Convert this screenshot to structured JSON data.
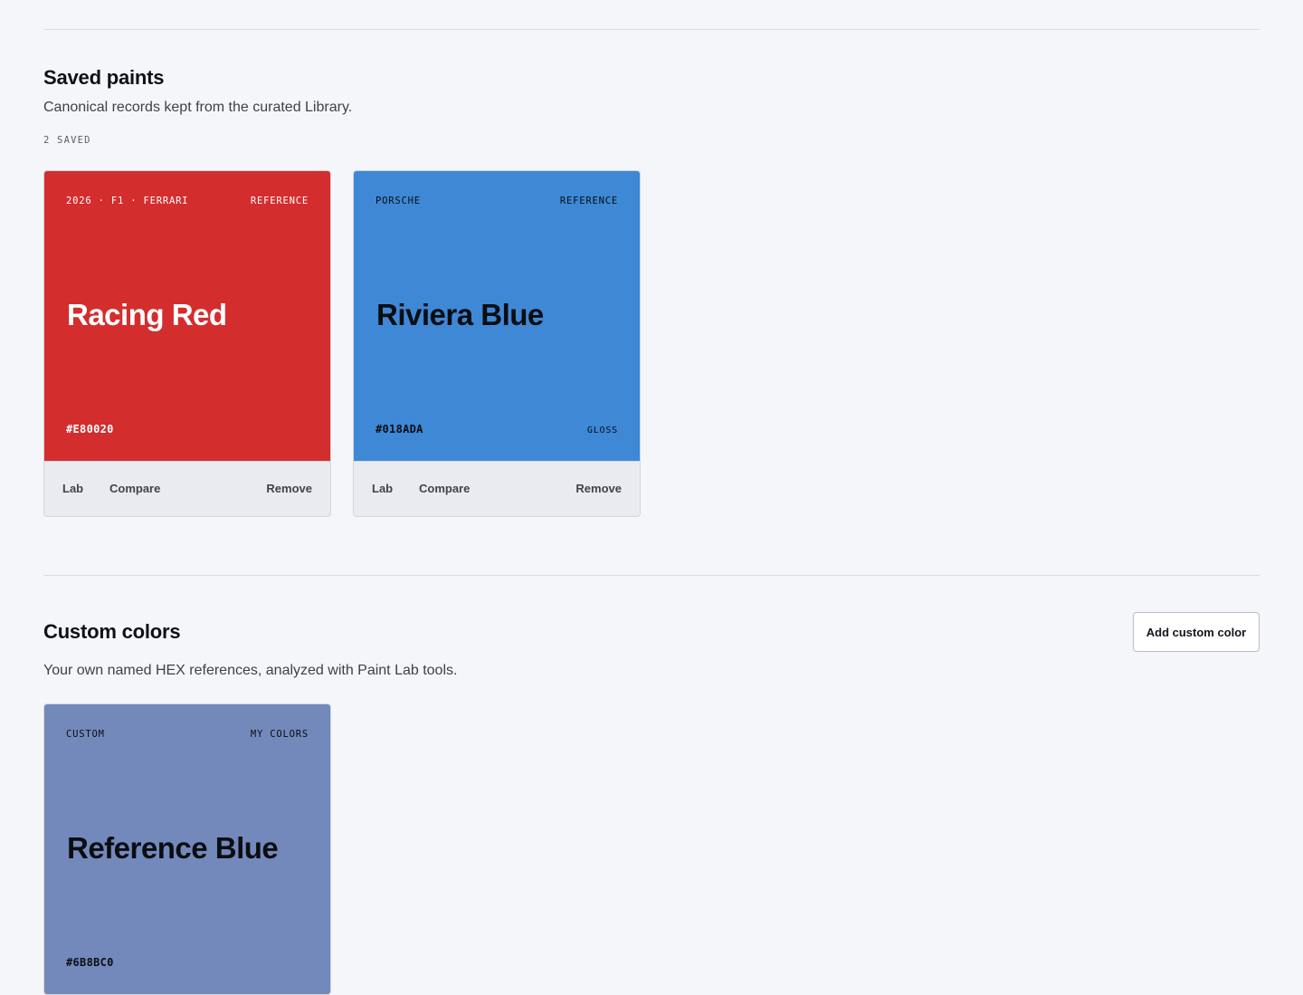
{
  "saved": {
    "title": "Saved paints",
    "description": "Canonical records kept from the curated Library.",
    "count_label": "2 SAVED",
    "cards": [
      {
        "meta_left": "2026 · F1 · FERRARI",
        "meta_right": "REFERENCE",
        "name": "Racing Red",
        "hex": "#E80020",
        "finish": "",
        "swatch_color": "#d42d2e",
        "text_color": "#ffffff",
        "actions": {
          "lab": "Lab",
          "compare": "Compare",
          "remove": "Remove"
        }
      },
      {
        "meta_left": "PORSCHE",
        "meta_right": "REFERENCE",
        "name": "Riviera Blue",
        "hex": "#018ADA",
        "finish": "GLOSS",
        "swatch_color": "#3e88d6",
        "text_color": "#0b0d12",
        "actions": {
          "lab": "Lab",
          "compare": "Compare",
          "remove": "Remove"
        }
      }
    ]
  },
  "custom": {
    "title": "Custom colors",
    "description": "Your own named HEX references, analyzed with Paint Lab tools.",
    "add_button": "Add custom color",
    "cards": [
      {
        "meta_left": "CUSTOM",
        "meta_right": "MY COLORS",
        "name": "Reference Blue",
        "hex": "#6B8BC0",
        "swatch_color": "#7389bb",
        "text_color": "#0b0d12"
      }
    ]
  }
}
